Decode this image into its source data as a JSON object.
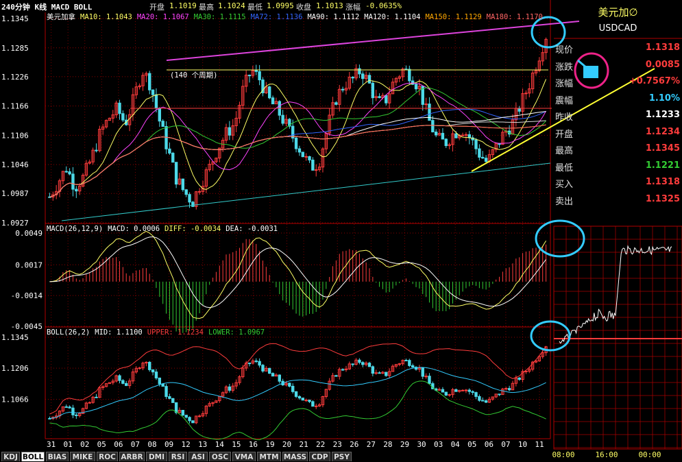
{
  "colors": {
    "up": "#ff3c3c",
    "down": "#4dd9e8",
    "axis": "#b00000",
    "yellow": "#ffff66",
    "white": "#ffffff",
    "green": "#33cc33",
    "magenta": "#ff44ff",
    "pink": "#ff33aa",
    "cyan": "#33ccff",
    "header_bg": "#000000"
  },
  "header": {
    "period_label": "240分钟 K线 MACD BOLL",
    "open_label": "开盘",
    "open_value": "1.1019",
    "high_label": "最高",
    "high_value": "1.1024",
    "low_label": "最低",
    "low_value": "1.0995",
    "close_label": "收盘",
    "close_value": "1.1013",
    "change_label": "涨幅",
    "change_value": "-0.0635%"
  },
  "ma_legend": [
    {
      "text": "美元加拿",
      "color": "#ffffff"
    },
    {
      "text": "MA10: 1.1043",
      "color": "#ffff66"
    },
    {
      "text": "MA20: 1.1067",
      "color": "#ff44ff"
    },
    {
      "text": "MA30: 1.1115",
      "color": "#33cc33"
    },
    {
      "text": "MA72: 1.1136",
      "color": "#3366ff"
    },
    {
      "text": "MA90: 1.1112",
      "color": "#ffffff"
    },
    {
      "text": "MA120: 1.1104",
      "color": "#ffffff"
    },
    {
      "text": "MA150: 1.1129",
      "color": "#ffaa00"
    },
    {
      "text": "MA180: 1.1170",
      "color": "#ff6666"
    }
  ],
  "annotation_period": "(140 个周期)",
  "macd_legend": [
    {
      "text": "MACD(26,12,9)",
      "color": "#ffffff"
    },
    {
      "text": "MACD: 0.0006",
      "color": "#ffffff"
    },
    {
      "text": "DIFF: -0.0034",
      "color": "#ffff66"
    },
    {
      "text": "DEA: -0.0031",
      "color": "#ffffff"
    }
  ],
  "boll_legend": [
    {
      "text": "BOLL(26,2)",
      "color": "#ffffff"
    },
    {
      "text": "MID: 1.1100",
      "color": "#ffffff"
    },
    {
      "text": "UPPER: 1.1234",
      "color": "#ff3c3c"
    },
    {
      "text": "LOWER: 1.0967",
      "color": "#33cc33"
    }
  ],
  "side": {
    "title": "美元加∅",
    "symbol": "USDCAD",
    "rows": [
      {
        "label": "现价",
        "value": "1.1318",
        "color": "#ff3c3c"
      },
      {
        "label": "涨跌",
        "value": "0.0085",
        "color": "#ff3c3c"
      },
      {
        "label": "涨幅",
        "value": "+0.7567%",
        "color": "#ff3c3c"
      },
      {
        "label": "震幅",
        "value": "1.10%",
        "color": "#33ccff"
      },
      {
        "label": "昨收",
        "value": "1.1233",
        "color": "#ffffff"
      },
      {
        "label": "开盘",
        "value": "1.1234",
        "color": "#ff3c3c"
      },
      {
        "label": "最高",
        "value": "1.1345",
        "color": "#ff3c3c"
      },
      {
        "label": "最低",
        "value": "1.1221",
        "color": "#33cc33"
      },
      {
        "label": "买入",
        "value": "1.1318",
        "color": "#ff3c3c"
      },
      {
        "label": "卖出",
        "value": "1.1325",
        "color": "#ff3c3c"
      }
    ],
    "time_labels": [
      "08:00",
      "16:00",
      "00:00"
    ]
  },
  "tabs": [
    "KDJ",
    "BOLL",
    "BIAS",
    "MIKE",
    "ROC",
    "ARBR",
    "DMI",
    "RSI",
    "ASI",
    "OSC",
    "VMA",
    "MTM",
    "MASS",
    "CDP",
    "PSY"
  ],
  "active_tab": "BOLL",
  "chart_data": {
    "type": "candlestick",
    "x_labels": [
      "31",
      "01",
      "02",
      "05",
      "06",
      "07",
      "08",
      "09",
      "12",
      "13",
      "14",
      "15",
      "16",
      "19",
      "20",
      "21",
      "22",
      "23",
      "26",
      "27",
      "28",
      "29",
      "30",
      "03",
      "04",
      "05",
      "06",
      "07",
      "10",
      "11"
    ],
    "price_axis": [
      "1.1345",
      "1.1285",
      "1.1226",
      "1.1166",
      "1.1106",
      "1.1046",
      "1.0987",
      "1.0927"
    ],
    "price_range": [
      1.0927,
      1.1345
    ],
    "macd_axis": [
      "0.0049",
      "0.0017",
      "-0.0014",
      "-0.0045"
    ],
    "macd_range": [
      -0.0045,
      0.0049
    ],
    "boll_axis": [
      "1.1345",
      "1.1206",
      "1.1066"
    ],
    "boll_range": [
      1.0975,
      1.1345
    ],
    "close_path": [
      1.098,
      1.101,
      1.104,
      1.1,
      1.102,
      1.106,
      1.111,
      1.114,
      1.116,
      1.113,
      1.118,
      1.124,
      1.121,
      1.114,
      1.108,
      1.102,
      1.099,
      1.097,
      1.101,
      1.104,
      1.108,
      1.111,
      1.113,
      1.12,
      1.124,
      1.122,
      1.118,
      1.116,
      1.113,
      1.11,
      1.107,
      1.104,
      1.105,
      1.112,
      1.118,
      1.121,
      1.122,
      1.124,
      1.121,
      1.117,
      1.118,
      1.122,
      1.124,
      1.123,
      1.12,
      1.114,
      1.11,
      1.109,
      1.111,
      1.112,
      1.11,
      1.107,
      1.105,
      1.108,
      1.111,
      1.113,
      1.117,
      1.121,
      1.126,
      1.131
    ]
  }
}
